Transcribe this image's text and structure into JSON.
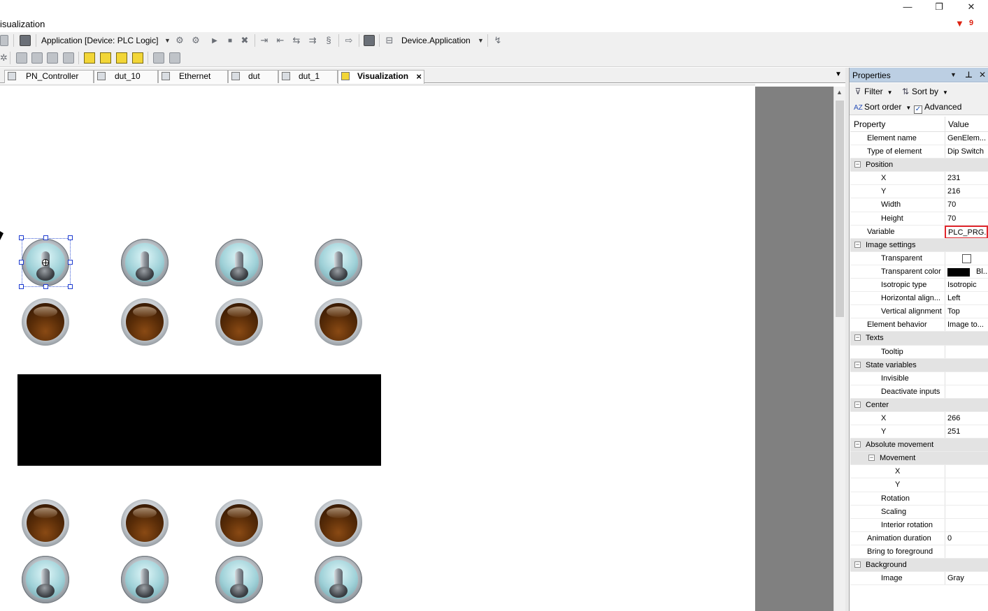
{
  "window": {
    "title": "isualization",
    "minimize": "—",
    "restore": "❐",
    "close": "✕",
    "notification_count": "9"
  },
  "toolbar": {
    "application_combo": "Application [Device: PLC Logic]",
    "device_combo": "Device.Application"
  },
  "tabs": [
    {
      "label": "PN_Controller"
    },
    {
      "label": "dut_10"
    },
    {
      "label": "Ethernet"
    },
    {
      "label": "dut"
    },
    {
      "label": "dut_1"
    },
    {
      "label": "Visualization",
      "active": true
    }
  ],
  "properties": {
    "title": "Properties",
    "filter_label": "Filter",
    "sort_by_label": "Sort by",
    "sort_order_label": "Sort order",
    "advanced_label": "Advanced",
    "advanced_checked": true,
    "col_property": "Property",
    "col_value": "Value",
    "rows": [
      {
        "name": "Element name",
        "value": "GenElem...",
        "level": 0
      },
      {
        "name": "Type of element",
        "value": "Dip Switch",
        "level": 0
      },
      {
        "name": "Position",
        "value": "",
        "level": 0,
        "category": true
      },
      {
        "name": "X",
        "value": "231",
        "level": 1
      },
      {
        "name": "Y",
        "value": "216",
        "level": 1
      },
      {
        "name": "Width",
        "value": "70",
        "level": 1
      },
      {
        "name": "Height",
        "value": "70",
        "level": 1
      },
      {
        "name": "Variable",
        "value": "PLC_PRG...",
        "level": 0,
        "highlight": true
      },
      {
        "name": "Image settings",
        "value": "",
        "level": 0,
        "category": true
      },
      {
        "name": "Transparent",
        "value": "",
        "level": 1,
        "checkbox": true
      },
      {
        "name": "Transparent color",
        "value": "Bl...",
        "level": 1,
        "swatch": "#000000"
      },
      {
        "name": "Isotropic type",
        "value": "Isotropic",
        "level": 1
      },
      {
        "name": "Horizontal align...",
        "value": "Left",
        "level": 1
      },
      {
        "name": "Vertical alignment",
        "value": "Top",
        "level": 1
      },
      {
        "name": "Element behavior",
        "value": "Image to...",
        "level": 0
      },
      {
        "name": "Texts",
        "value": "",
        "level": 0,
        "category": true
      },
      {
        "name": "Tooltip",
        "value": "",
        "level": 1
      },
      {
        "name": "State variables",
        "value": "",
        "level": 0,
        "category": true
      },
      {
        "name": "Invisible",
        "value": "",
        "level": 1
      },
      {
        "name": "Deactivate inputs",
        "value": "",
        "level": 1
      },
      {
        "name": "Center",
        "value": "",
        "level": 0,
        "category": true
      },
      {
        "name": "X",
        "value": "266",
        "level": 1
      },
      {
        "name": "Y",
        "value": "251",
        "level": 1
      },
      {
        "name": "Absolute movement",
        "value": "",
        "level": 0,
        "category": true
      },
      {
        "name": "Movement",
        "value": "",
        "level": 1,
        "category": true
      },
      {
        "name": "X",
        "value": "",
        "level": 2
      },
      {
        "name": "Y",
        "value": "",
        "level": 2
      },
      {
        "name": "Rotation",
        "value": "",
        "level": 1
      },
      {
        "name": "Scaling",
        "value": "",
        "level": 1
      },
      {
        "name": "Interior rotation",
        "value": "",
        "level": 1
      },
      {
        "name": "Animation duration",
        "value": "0",
        "level": 0
      },
      {
        "name": "Bring to foreground",
        "value": "",
        "level": 0
      },
      {
        "name": "Background",
        "value": "",
        "level": 0,
        "category": true
      },
      {
        "name": "Image",
        "value": "Gray",
        "level": 1
      }
    ]
  },
  "canvas": {
    "elements": [
      {
        "type": "dip-switch"
      },
      {
        "type": "dip-switch"
      },
      {
        "type": "dip-switch"
      },
      {
        "type": "dip-switch"
      },
      {
        "type": "lamp"
      },
      {
        "type": "lamp"
      },
      {
        "type": "lamp"
      },
      {
        "type": "lamp"
      },
      {
        "type": "rectangle"
      },
      {
        "type": "lamp"
      },
      {
        "type": "lamp"
      },
      {
        "type": "lamp"
      },
      {
        "type": "lamp"
      },
      {
        "type": "dip-switch"
      },
      {
        "type": "dip-switch"
      },
      {
        "type": "dip-switch"
      },
      {
        "type": "dip-switch"
      }
    ]
  }
}
